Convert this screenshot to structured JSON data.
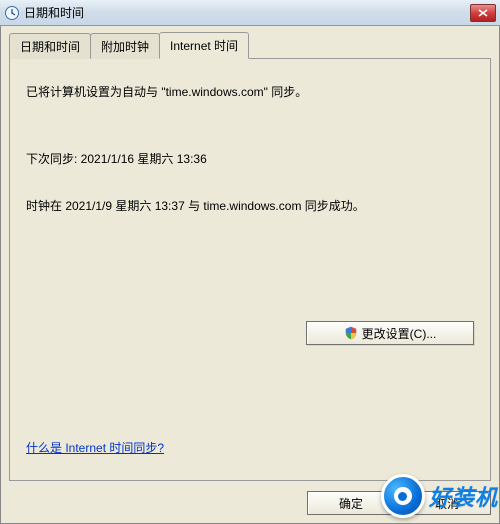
{
  "titlebar": {
    "title": "日期和时间"
  },
  "tabs": {
    "date_time": "日期和时间",
    "additional_clocks": "附加时钟",
    "internet_time": "Internet 时间"
  },
  "panel": {
    "sync_config": "已将计算机设置为自动与 \"time.windows.com\" 同步。",
    "next_sync": "下次同步: 2021/1/16 星期六 13:36",
    "last_sync": "时钟在 2021/1/9 星期六 13:37 与 time.windows.com 同步成功。",
    "change_settings": "更改设置(C)...",
    "help_link": "什么是 Internet 时间同步?"
  },
  "footer": {
    "ok": "确定",
    "cancel": "取消"
  },
  "watermark": {
    "text": "好装机"
  }
}
